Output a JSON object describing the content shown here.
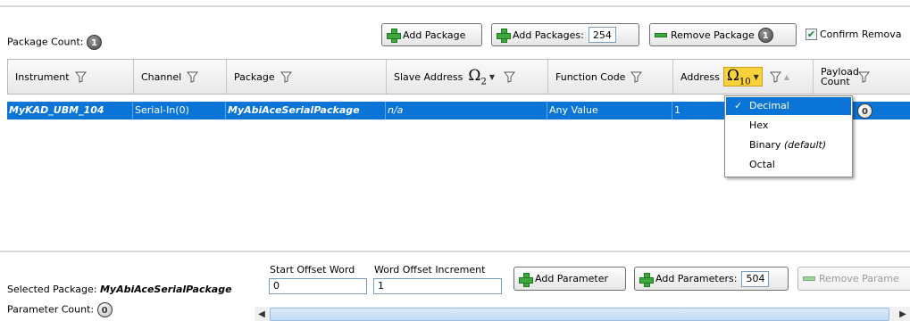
{
  "toolbar": {
    "package_count_label": "Package Count:",
    "package_count": "1",
    "add_package": "Add Package",
    "add_packages": "Add Packages:",
    "add_packages_value": "254",
    "remove_package": "Remove Package",
    "remove_package_badge": "1",
    "confirm_removal": "Confirm Remova",
    "confirm_checked": true
  },
  "grid": {
    "columns": [
      "Instrument",
      "Channel",
      "Package",
      "Slave Address",
      "Function Code",
      "Address",
      "Payload Count"
    ],
    "radix_symbol": "Ω",
    "slave_radix": "2",
    "address_radix": "10",
    "rows": [
      {
        "instrument": "MyKAD_UBM_104",
        "channel": "Serial-In(0)",
        "package": "MyAbiAceSerialPackage",
        "slave_address": "n/a",
        "function_code": "Any Value",
        "address": "1",
        "payload_count": "0"
      }
    ]
  },
  "radix_menu": {
    "items": [
      {
        "label": "Decimal",
        "suffix": "",
        "selected": true
      },
      {
        "label": "Hex",
        "suffix": "",
        "selected": false
      },
      {
        "label": "Binary ",
        "suffix": "(default)",
        "selected": false
      },
      {
        "label": "Octal",
        "suffix": "",
        "selected": false
      }
    ]
  },
  "bottom": {
    "selected_package_label": "Selected Package:",
    "selected_package": "MyAbiAceSerialPackage",
    "parameter_count_label": "Parameter Count:",
    "parameter_count": "0",
    "start_offset_label": "Start Offset Word",
    "start_offset_value": "0",
    "word_offset_label": "Word Offset Increment",
    "word_offset_value": "1",
    "add_parameter": "Add Parameter",
    "add_parameters": "Add Parameters:",
    "add_parameters_value": "504",
    "remove_parameter": "Remove Parame"
  },
  "colors": {
    "selection": "#0a75d6",
    "address_highlight": "#f7d23a",
    "plus_green": "#3ea83e"
  }
}
